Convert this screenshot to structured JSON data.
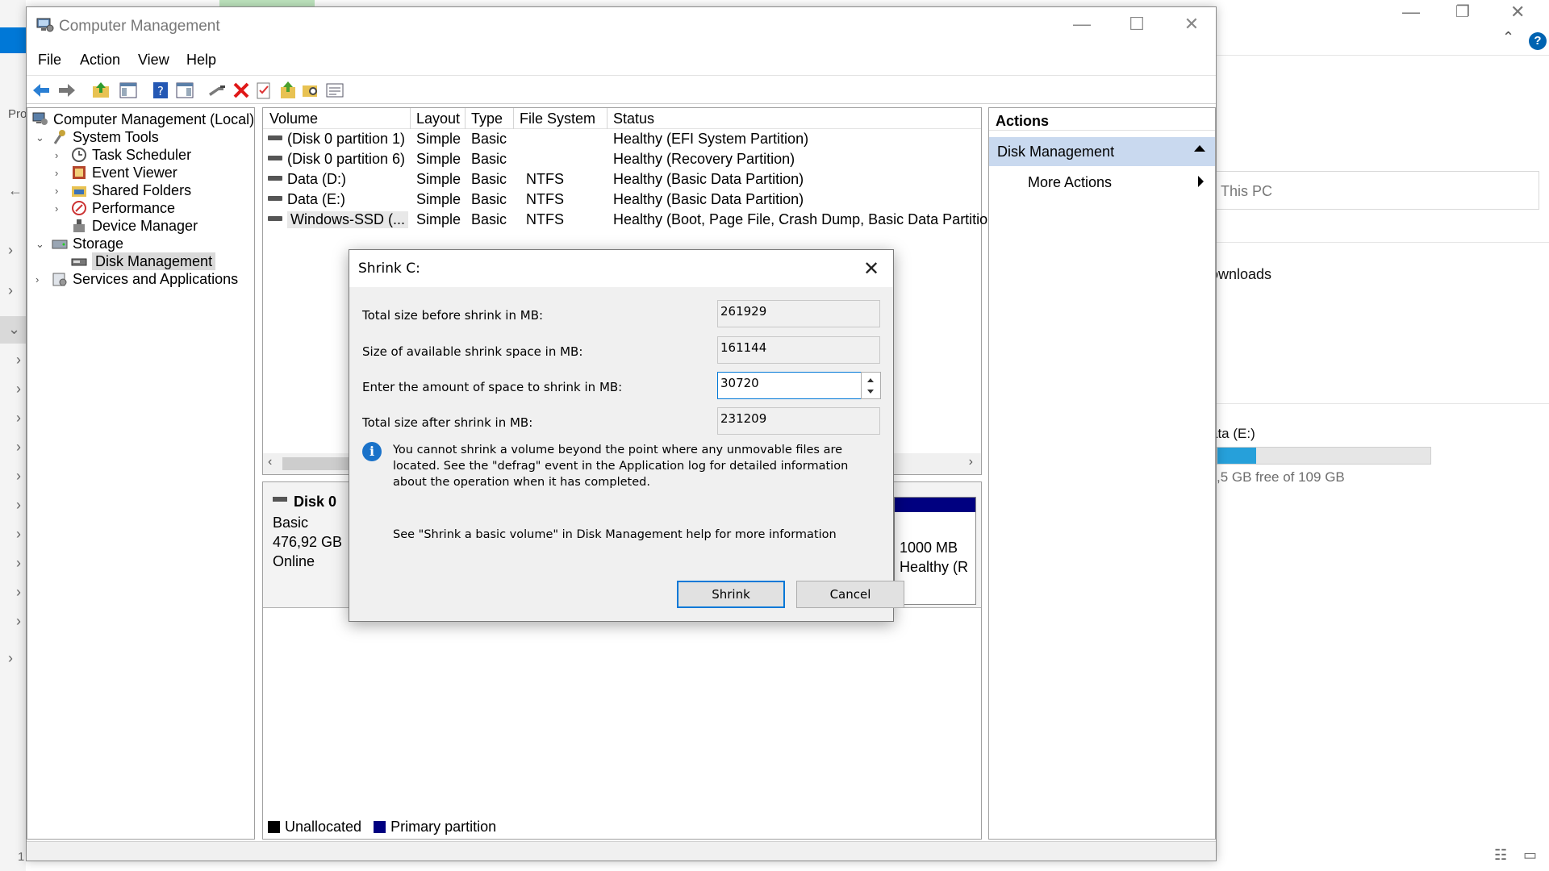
{
  "background_window": {
    "address_text": "This PC",
    "downloads_label": "ownloads",
    "drive_label": "ata (E:)",
    "drive_free_text": ",5 GB free of 109 GB",
    "drive_used_fraction": 0.18,
    "pro_text": "Pro",
    "bottom_number": "1"
  },
  "window": {
    "title": "Computer Management",
    "menus": [
      "File",
      "Action",
      "View",
      "Help"
    ]
  },
  "tree": {
    "root": "Computer Management (Local)",
    "system_tools": "System Tools",
    "task_scheduler": "Task Scheduler",
    "event_viewer": "Event Viewer",
    "shared_folders": "Shared Folders",
    "performance": "Performance",
    "device_manager": "Device Manager",
    "storage": "Storage",
    "disk_management": "Disk Management",
    "services": "Services and Applications"
  },
  "volumes": {
    "columns": [
      "Volume",
      "Layout",
      "Type",
      "File System",
      "Status"
    ],
    "rows": [
      [
        "(Disk 0 partition 1)",
        "Simple",
        "Basic",
        "",
        "Healthy (EFI System Partition)"
      ],
      [
        "(Disk 0 partition 6)",
        "Simple",
        "Basic",
        "",
        "Healthy (Recovery Partition)"
      ],
      [
        "Data (D:)",
        "Simple",
        "Basic",
        "NTFS",
        "Healthy (Basic Data Partition)"
      ],
      [
        "Data (E:)",
        "Simple",
        "Basic",
        "NTFS",
        "Healthy (Basic Data Partition)"
      ],
      [
        "Windows-SSD (...",
        "Simple",
        "Basic",
        "NTFS",
        "Healthy (Boot, Page File, Crash Dump, Basic Data Partition"
      ]
    ]
  },
  "disk": {
    "name": "Disk 0",
    "type": "Basic",
    "size": "476,92 GB",
    "state": "Online",
    "partition_size": "1000 MB",
    "partition_status": "Healthy (R",
    "legend_unallocated": "Unallocated",
    "legend_primary": "Primary partition",
    "colors": {
      "unallocated": "#000000",
      "primary": "#000080"
    }
  },
  "actions": {
    "header": "Actions",
    "section": "Disk Management",
    "more": "More Actions"
  },
  "dialog": {
    "title": "Shrink C:",
    "total_before_label": "Total size before shrink in MB:",
    "total_before_value": "261929",
    "available_label": "Size of available shrink space in MB:",
    "available_value": "161144",
    "amount_label": "Enter the amount of space to shrink in MB:",
    "amount_value": "30720",
    "total_after_label": "Total size after shrink in MB:",
    "total_after_value": "231209",
    "info_text": "You cannot shrink a volume beyond the point where any unmovable files are located. See the \"defrag\" event in the Application log for detailed information about the operation when it has completed.",
    "help_text": "See \"Shrink a basic volume\" in Disk Management help for more information",
    "shrink_label": "Shrink",
    "cancel_label": "Cancel"
  }
}
